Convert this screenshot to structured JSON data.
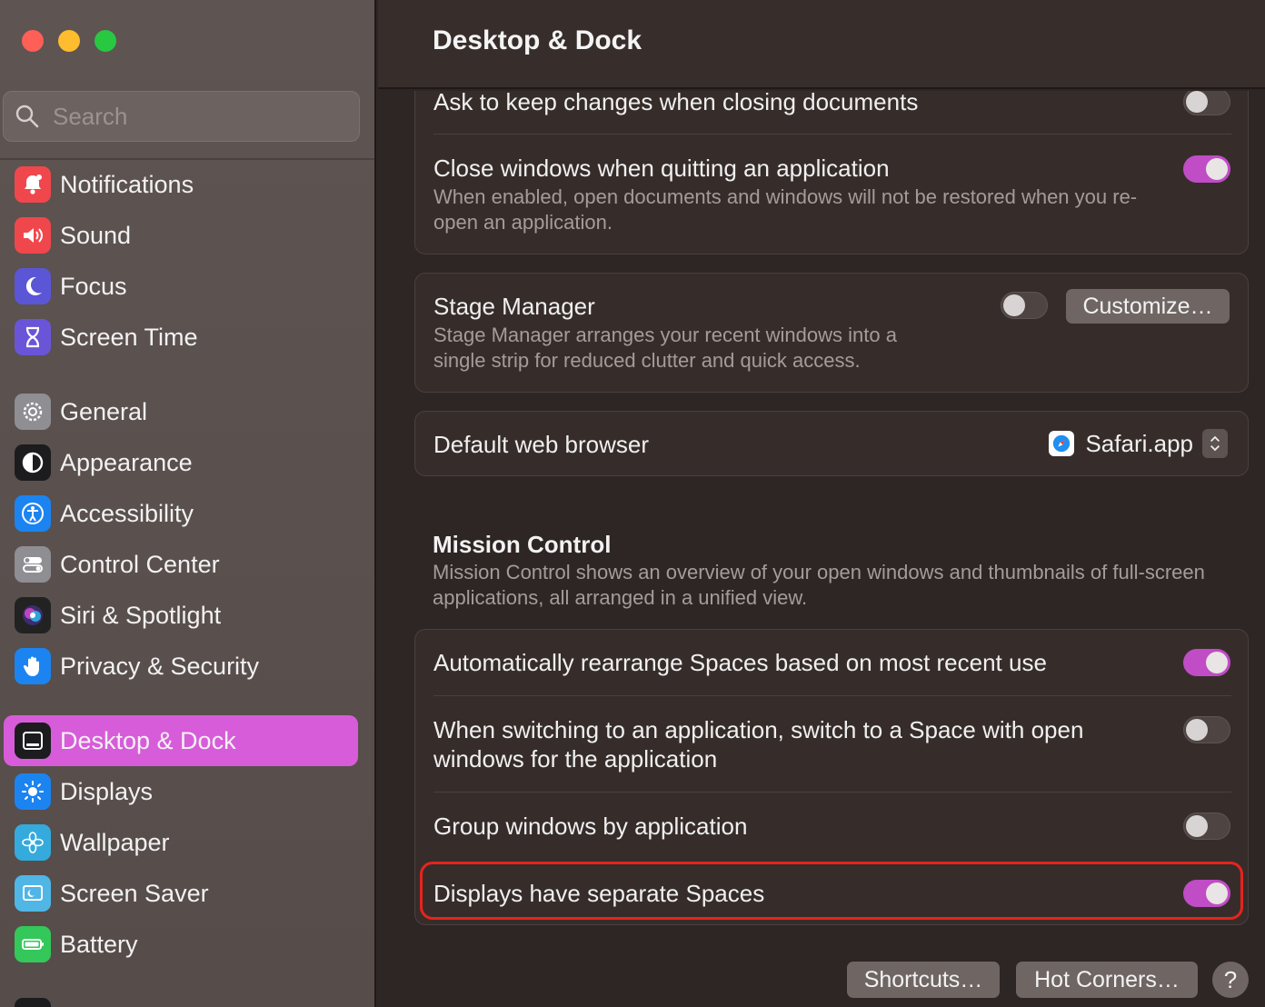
{
  "window": {
    "title": "Desktop & Dock"
  },
  "search": {
    "placeholder": "Search"
  },
  "sidebar": {
    "items": [
      {
        "label": "Notifications",
        "icon": "bell-icon",
        "color": "#f0474c"
      },
      {
        "label": "Sound",
        "icon": "speaker-icon",
        "color": "#f0474c"
      },
      {
        "label": "Focus",
        "icon": "moon-icon",
        "color": "#5b56d6"
      },
      {
        "label": "Screen Time",
        "icon": "hourglass-icon",
        "color": "#6a55d8"
      },
      {
        "label": "General",
        "icon": "gear-icon",
        "color": "#8e8e93"
      },
      {
        "label": "Appearance",
        "icon": "appearance-icon",
        "color": "#1c1c1e"
      },
      {
        "label": "Accessibility",
        "icon": "accessibility-icon",
        "color": "#1b84f0"
      },
      {
        "label": "Control Center",
        "icon": "control-center-icon",
        "color": "#8e8e93"
      },
      {
        "label": "Siri & Spotlight",
        "icon": "siri-icon",
        "color": "#222"
      },
      {
        "label": "Privacy & Security",
        "icon": "hand-icon",
        "color": "#1b84f0"
      },
      {
        "label": "Desktop & Dock",
        "icon": "dock-icon",
        "color": "#1c1c1e",
        "active": true
      },
      {
        "label": "Displays",
        "icon": "sun-icon",
        "color": "#1b84f0"
      },
      {
        "label": "Wallpaper",
        "icon": "flower-icon",
        "color": "#35aadc"
      },
      {
        "label": "Screen Saver",
        "icon": "screensaver-icon",
        "color": "#4fb6e6"
      },
      {
        "label": "Battery",
        "icon": "battery-icon",
        "color": "#34c759"
      }
    ]
  },
  "settings": {
    "ask_keep_changes": {
      "title": "Ask to keep changes when closing documents",
      "on": false
    },
    "close_windows": {
      "title": "Close windows when quitting an application",
      "subtitle": "When enabled, open documents and windows will not be restored when you re-open an application.",
      "on": true
    },
    "stage_manager": {
      "title": "Stage Manager",
      "subtitle": "Stage Manager arranges your recent windows into a single strip for reduced clutter and quick access.",
      "on": false,
      "button": "Customize…"
    },
    "default_browser": {
      "title": "Default web browser",
      "value": "Safari.app"
    }
  },
  "mission_control": {
    "title": "Mission Control",
    "subtitle": "Mission Control shows an overview of your open windows and thumbnails of full-screen applications, all arranged in a unified view.",
    "rearrange": {
      "title": "Automatically rearrange Spaces based on most recent use",
      "on": true
    },
    "switch_space": {
      "title": "When switching to an application, switch to a Space with open windows for the application",
      "on": false
    },
    "group_windows": {
      "title": "Group windows by application",
      "on": false
    },
    "separate_spaces": {
      "title": "Displays have separate Spaces",
      "on": true
    }
  },
  "footer": {
    "shortcuts": "Shortcuts…",
    "hot_corners": "Hot Corners…",
    "help": "?"
  },
  "colors": {
    "accent": "#c04cc6",
    "sidebar_active": "#d75cd9",
    "highlight": "#e8231c"
  }
}
